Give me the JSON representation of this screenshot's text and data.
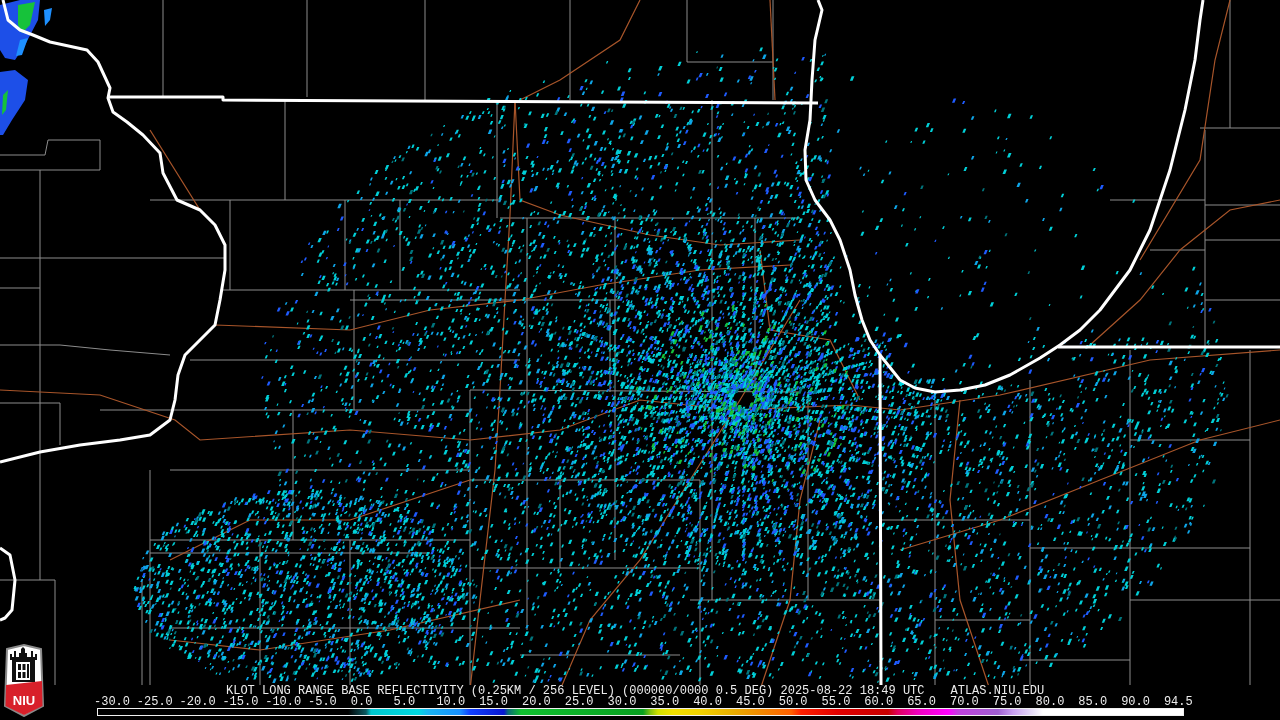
{
  "logo": {
    "text": "NIU"
  },
  "legend": {
    "title": "KLOT LONG RANGE BASE REFLECTIVITY (0.25KM / 256 LEVEL) (000000/0000 0.5 DEG) 2025-08-22 18:49 UTC",
    "source": "ATLAS.NIU.EDU",
    "ticks": [
      "-30.0",
      "-25.0",
      "-20.0",
      "-15.0",
      "-10.0",
      "-5.0",
      "0.0",
      "5.0",
      "10.0",
      "15.0",
      "20.0",
      "25.0",
      "30.0",
      "35.0",
      "40.0",
      "45.0",
      "50.0",
      "55.0",
      "60.0",
      "65.0",
      "70.0",
      "75.0",
      "80.0",
      "85.0",
      "90.0",
      "94.5"
    ]
  }
}
